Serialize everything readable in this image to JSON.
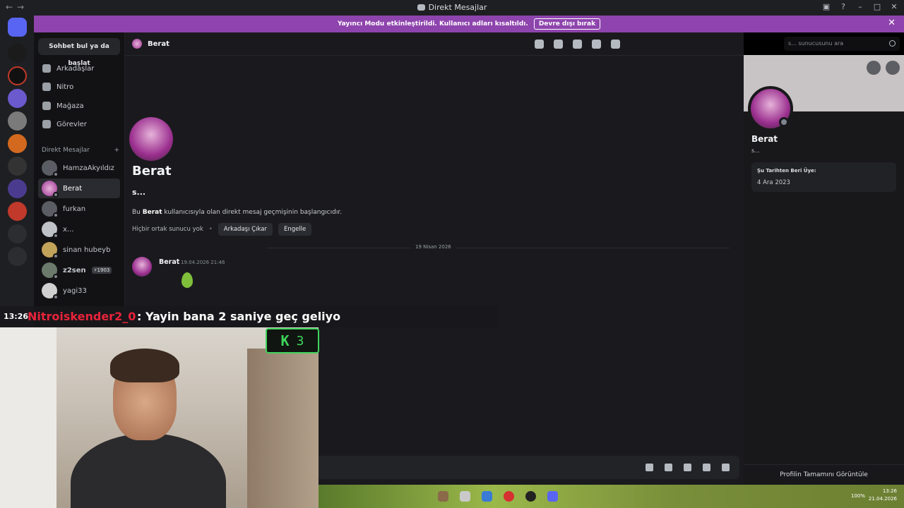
{
  "window": {
    "title": "Direkt Mesajlar"
  },
  "streamer_banner": {
    "text": "Yayıncı Modu etkinleştirildi. Kullanıcı adları kısaltıldı.",
    "button": "Devre dışı bırak"
  },
  "sidebar": {
    "find_button": "Sohbet bul ya da başlat",
    "nav": [
      {
        "label": "Arkadaşlar",
        "icon": "friends-icon"
      },
      {
        "label": "Nitro",
        "icon": "nitro-icon"
      },
      {
        "label": "Mağaza",
        "icon": "shop-icon"
      },
      {
        "label": "Görevler",
        "icon": "quests-icon"
      }
    ],
    "section_label": "Direkt Mesajlar",
    "section_add": "+",
    "dms": [
      {
        "name": "HamzaAkyıldız"
      },
      {
        "name": "Berat",
        "active": true
      },
      {
        "name": "furkan"
      },
      {
        "name": "x..."
      },
      {
        "name": "sinan hubeyb"
      },
      {
        "name": "z2sen",
        "tag": "⚡1903"
      },
      {
        "name": "yagi33"
      }
    ]
  },
  "chat": {
    "header_name": "Berat",
    "search_placeholder": "s... sunucusunu ara",
    "profile_name": "Berat",
    "profile_sub": "s...",
    "intro_prefix": "Bu ",
    "intro_name": "Berat",
    "intro_suffix": " kullanıcısıyla olan direkt mesaj geçmişinin başlangıcıdır.",
    "no_mutual": "Hiçbir ortak sunucu yok",
    "remove_friend": "Arkadaşı Çıkar",
    "block": "Engelle",
    "date_divider": "19 Nisan 2026",
    "message": {
      "author": "Berat",
      "time": "19.04.2026 21:46"
    }
  },
  "profile_panel": {
    "name": "Berat",
    "sub": "s...",
    "member_since_label": "Şu Tarihten Beri Üye:",
    "member_since": "4 Ara 2023",
    "view_full": "Profilin Tamamını Görüntüle"
  },
  "stream_overlay": {
    "time": "13:26",
    "user": "Nitroiskender2_0",
    "message": ": Yayin bana 2 saniye geç geliyo"
  },
  "k_badge": {
    "letter": "K",
    "number": "3"
  },
  "taskbar": {
    "battery": "100%",
    "time": "13:26",
    "date": "21.04.2026"
  },
  "colors": {
    "banner": "#8e44ad",
    "overlay_user": "#e8233a",
    "accent_green": "#3fd45a"
  }
}
